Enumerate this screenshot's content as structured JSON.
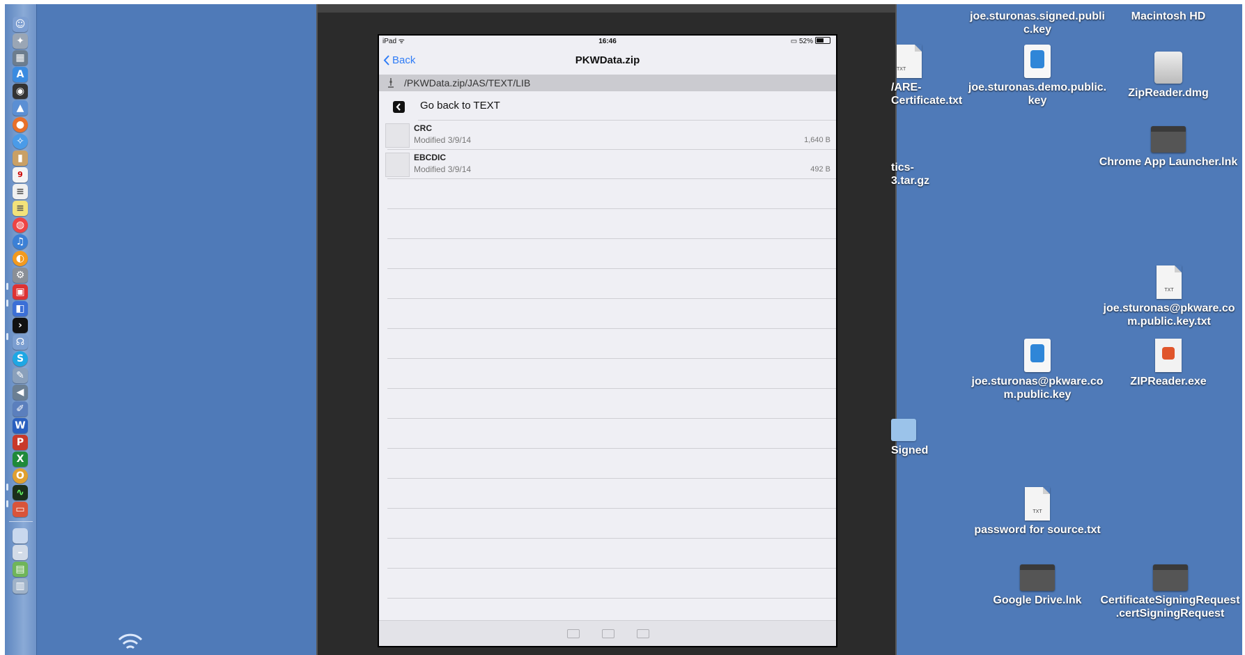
{
  "ipad": {
    "status": {
      "device": "iPad",
      "time": "16:46",
      "battery": "52%"
    },
    "nav": {
      "back_label": "Back",
      "title": "PKWData.zip"
    },
    "path": "/PKWData.zip/JAS/TEXT/LIB",
    "go_back": "Go back to TEXT",
    "files": [
      {
        "name": "CRC",
        "modified": "Modified 3/9/14",
        "size": "1,640 B"
      },
      {
        "name": "EBCDIC",
        "modified": "Modified 3/9/14",
        "size": "492 B"
      }
    ]
  },
  "desktop": {
    "items": [
      {
        "label": "joe.sturonas.signed.publi\nc.key",
        "icon": "key-file-icon"
      },
      {
        "label": "Macintosh HD",
        "icon": "hard-drive-icon"
      },
      {
        "label": "/ARE-\nCertificate.txt",
        "icon": "text-file-icon",
        "ext": "TXT"
      },
      {
        "label": "joe.sturonas.demo.public.\nkey",
        "icon": "keynote-file-icon"
      },
      {
        "label": "ZipReader.dmg",
        "icon": "disk-image-icon"
      },
      {
        "label": "Chrome App Launcher.lnk",
        "icon": "shortcut-icon"
      },
      {
        "label": "tics-\n3.tar.gz",
        "icon": "archive-icon"
      },
      {
        "label": "joe.sturonas@pkware.co\nm.public.key.txt",
        "icon": "text-file-icon",
        "ext": "TXT"
      },
      {
        "label": "joe.sturonas@pkware.co\nm.public.key",
        "icon": "keynote-file-icon"
      },
      {
        "label": "ZIPReader.exe",
        "icon": "exe-file-icon"
      },
      {
        "label": "Signed",
        "icon": "folder-icon"
      },
      {
        "label": "password for source.txt",
        "icon": "text-file-icon",
        "ext": "TXT"
      },
      {
        "label": "Google Drive.lnk",
        "icon": "shortcut-icon"
      },
      {
        "label": "CertificateSigningRequest\n.certSigningRequest",
        "icon": "shortcut-icon"
      }
    ]
  },
  "colors": {
    "desktop": "#4f7ab8",
    "ios_blue": "#2f7cf6",
    "sim_bg": "#2b2b2b"
  }
}
